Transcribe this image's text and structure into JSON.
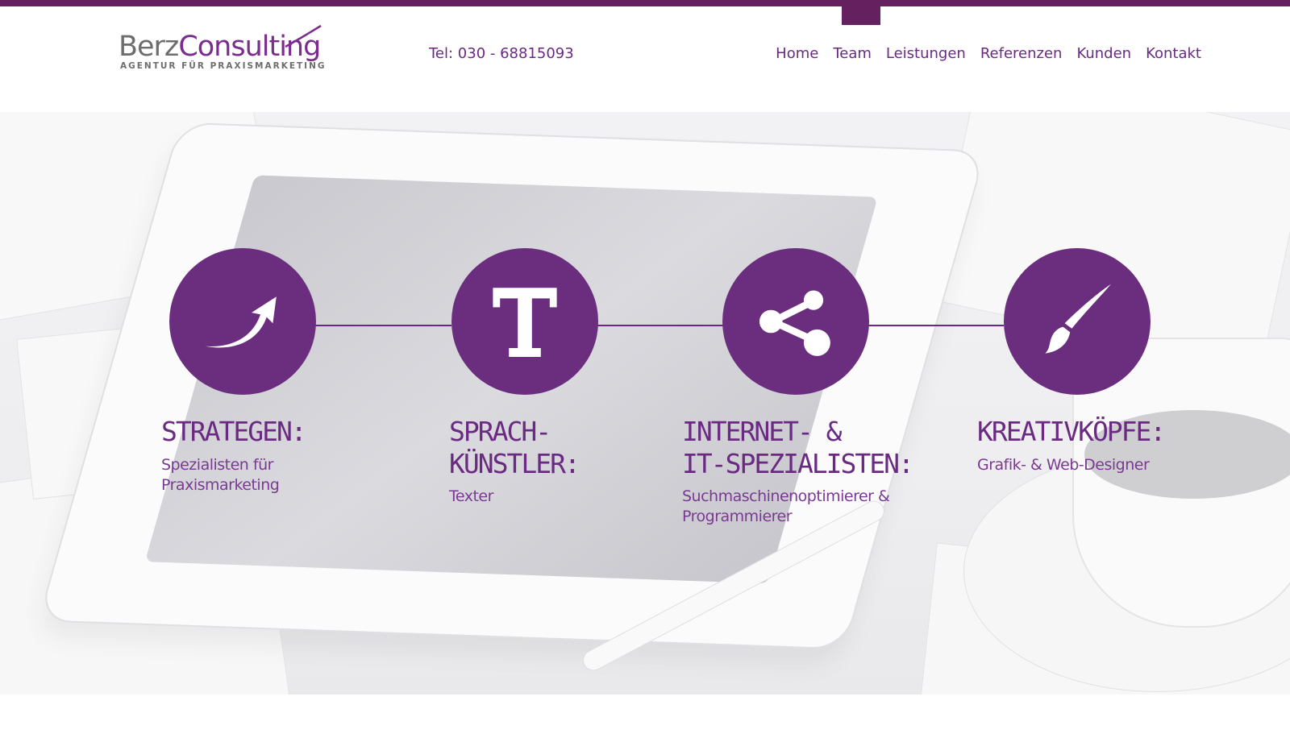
{
  "logo": {
    "brand_part1": "Berz",
    "brand_part2": "Consulting",
    "tagline": "AGENTUR FÜR PRAXISMARKETING"
  },
  "header": {
    "phone": "Tel: 030 - 68815093"
  },
  "nav": {
    "items": [
      {
        "label": "Home"
      },
      {
        "label": "Team"
      },
      {
        "label": "Leistungen"
      },
      {
        "label": "Referenzen"
      },
      {
        "label": "Kunden"
      },
      {
        "label": "Kontakt"
      }
    ]
  },
  "colors": {
    "brand_purple": "#6b2d7d",
    "topbar": "#64205f",
    "logo_gray": "#6d6d6d"
  },
  "features": [
    {
      "icon": "arrow-curve-up-icon",
      "title": "STRATEGEN:",
      "subtitle": "Spezialisten für\nPraxismarketing"
    },
    {
      "icon": "text-t-icon",
      "title": "SPRACH-\nKÜNSTLER:",
      "subtitle": "Texter"
    },
    {
      "icon": "share-icon",
      "title": "INTERNET- &\nIT-SPEZIALISTEN:",
      "subtitle": "Suchmaschinenoptimierer &\nProgrammierer"
    },
    {
      "icon": "paintbrush-icon",
      "title": "KREATIVKÖPFE:",
      "subtitle": "Grafik- & Web-Designer"
    }
  ]
}
